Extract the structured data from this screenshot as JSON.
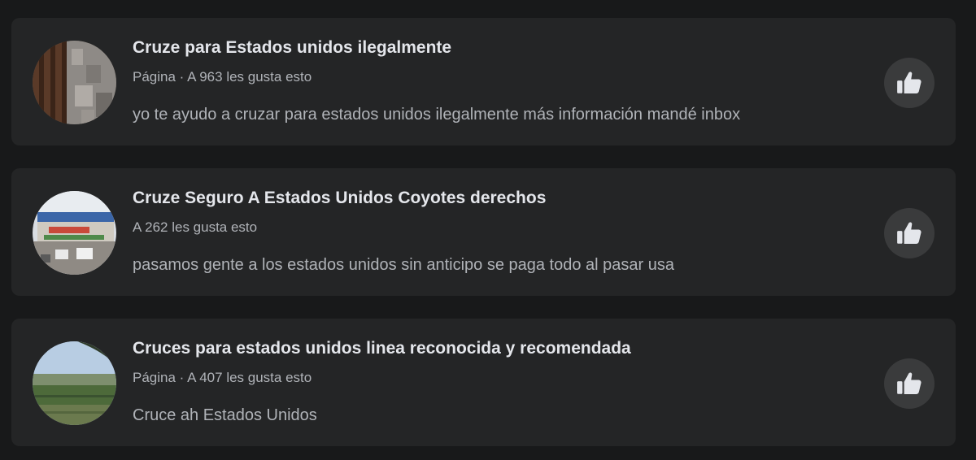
{
  "results": [
    {
      "title": "Cruze para Estados unidos ilegalmente",
      "meta": "Página · A 963 les gusta esto",
      "description": "yo te ayudo a cruzar para estados unidos ilegalmente más información mandé inbox",
      "avatar_icon": "page-photo-wall",
      "like_icon": "thumbs-up-icon"
    },
    {
      "title": "Cruze Seguro A Estados Unidos Coyotes derechos",
      "meta": "A 262 les gusta esto",
      "description": "pasamos gente a los estados unidos sin anticipo se paga todo al pasar usa",
      "avatar_icon": "page-photo-border-crossing",
      "like_icon": "thumbs-up-icon"
    },
    {
      "title": "Cruces para estados unidos linea reconocida y recomendada",
      "meta": "Página · A 407 les gusta esto",
      "description": "Cruce ah Estados Unidos",
      "avatar_icon": "page-photo-field",
      "like_icon": "thumbs-up-icon"
    }
  ],
  "colors": {
    "background": "#18191a",
    "card": "#242526",
    "title_text": "#e4e6eb",
    "secondary_text": "#b0b3b8",
    "like_button": "#3a3b3c"
  }
}
